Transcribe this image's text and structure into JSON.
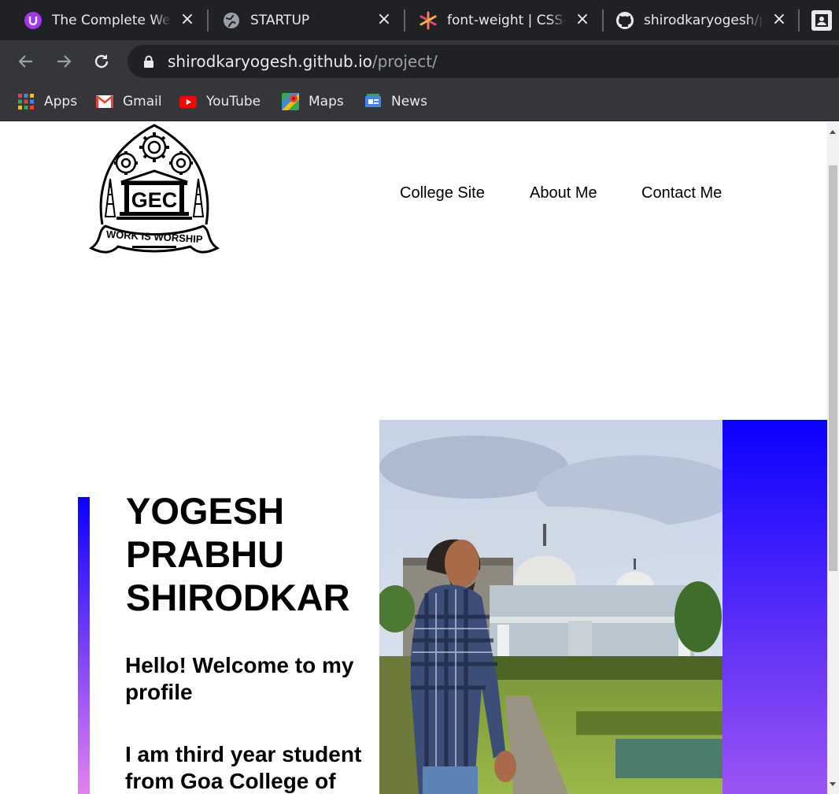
{
  "browser": {
    "tabs": [
      {
        "title": "The Complete Web Developer",
        "icon": "udemy-icon",
        "color": "#a435f0"
      },
      {
        "title": "STARTUP",
        "icon": "globe-icon"
      },
      {
        "title": "font-weight | CSS-Tricks",
        "icon": "css-tricks-icon",
        "color": "#ff7a59"
      },
      {
        "title": "shirodkaryogesh/project",
        "icon": "github-icon"
      }
    ],
    "url_host": "shirodkaryogesh.github.io",
    "url_path": "/project/",
    "bookmarks": [
      {
        "label": "Apps",
        "icon": "apps-grid-icon"
      },
      {
        "label": "Gmail",
        "icon": "gmail-icon"
      },
      {
        "label": "YouTube",
        "icon": "youtube-icon"
      },
      {
        "label": "Maps",
        "icon": "maps-icon"
      },
      {
        "label": "News",
        "icon": "news-icon"
      }
    ]
  },
  "site": {
    "logo": {
      "motto": "WORK IS WORSHIP",
      "initials": "GEC"
    },
    "nav": [
      "College Site",
      "About Me",
      "Contact Me"
    ],
    "hero": {
      "name_lines": [
        "YOGESH",
        "PRABHU",
        "SHIRODKAR"
      ],
      "welcome": "Hello! Welcome to my profile",
      "intro": "I am third year student from Goa College of"
    },
    "colors": {
      "accent_top": "#0a00ff",
      "accent_bottom": "#e680f0",
      "panel_bottom": "#9c55f2"
    }
  }
}
